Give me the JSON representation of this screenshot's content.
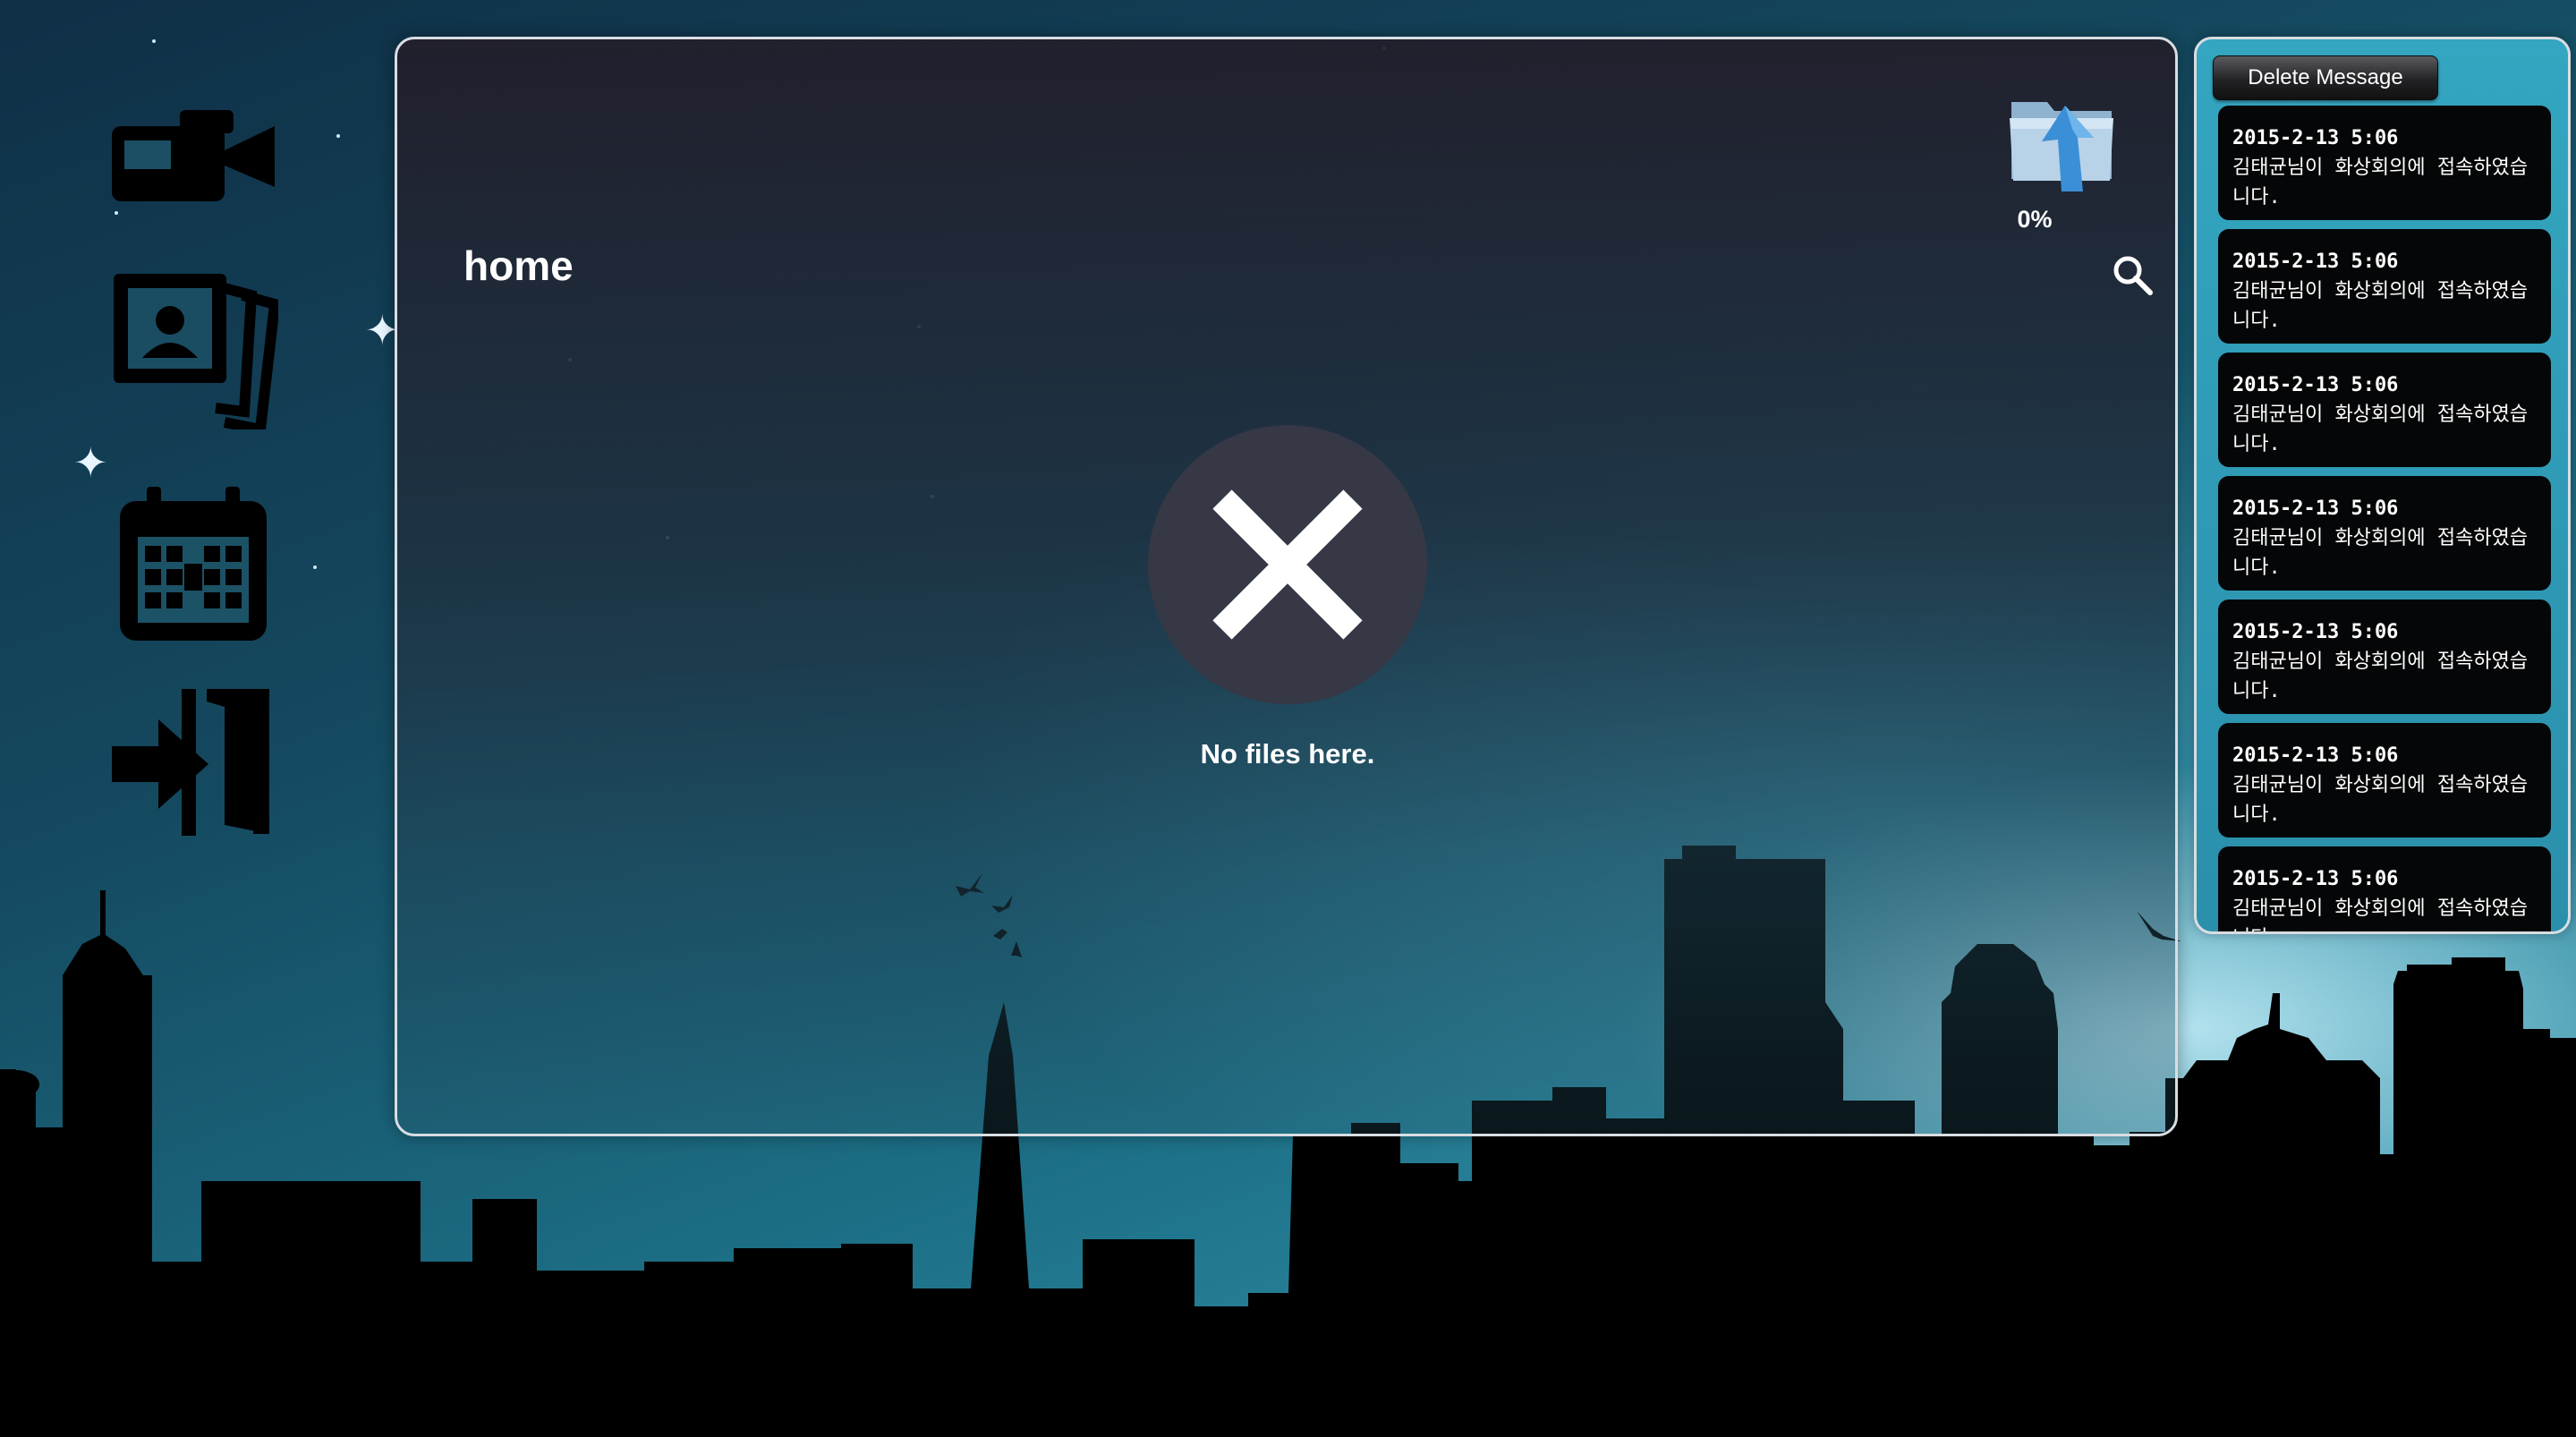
{
  "app": {
    "nav": [
      {
        "id": "video-conference",
        "icon": "video-camera-icon"
      },
      {
        "id": "photos",
        "icon": "photo-stack-icon"
      },
      {
        "id": "calendar",
        "icon": "calendar-icon"
      },
      {
        "id": "logout",
        "icon": "exit-door-icon"
      }
    ]
  },
  "file_panel": {
    "title": "home",
    "upload_progress": "0%",
    "empty_message": "No files here."
  },
  "messages": {
    "delete_label": "Delete Message",
    "items": [
      {
        "time": "2015-2-13 5:06",
        "text": "김태균님이 화상회의에 접속하였습니다."
      },
      {
        "time": "2015-2-13 5:06",
        "text": "김태균님이 화상회의에 접속하였습니다."
      },
      {
        "time": "2015-2-13 5:06",
        "text": "김태균님이 화상회의에 접속하였습니다."
      },
      {
        "time": "2015-2-13 5:06",
        "text": "김태균님이 화상회의에 접속하였습니다."
      },
      {
        "time": "2015-2-13 5:06",
        "text": "김태균님이 화상회의에 접속하였습니다."
      },
      {
        "time": "2015-2-13 5:06",
        "text": "김태균님이 화상회의에 접속하였습니다."
      },
      {
        "time": "2015-2-13 5:06",
        "text": "김태균님이 화상회의에 접속하였습니다."
      }
    ]
  },
  "colors": {
    "panel_border": "#d9dde2",
    "message_panel": "#34a6c1",
    "message_card": "#050607",
    "empty_circle": "#363845",
    "upload_arrow": "#3b8fd6"
  }
}
